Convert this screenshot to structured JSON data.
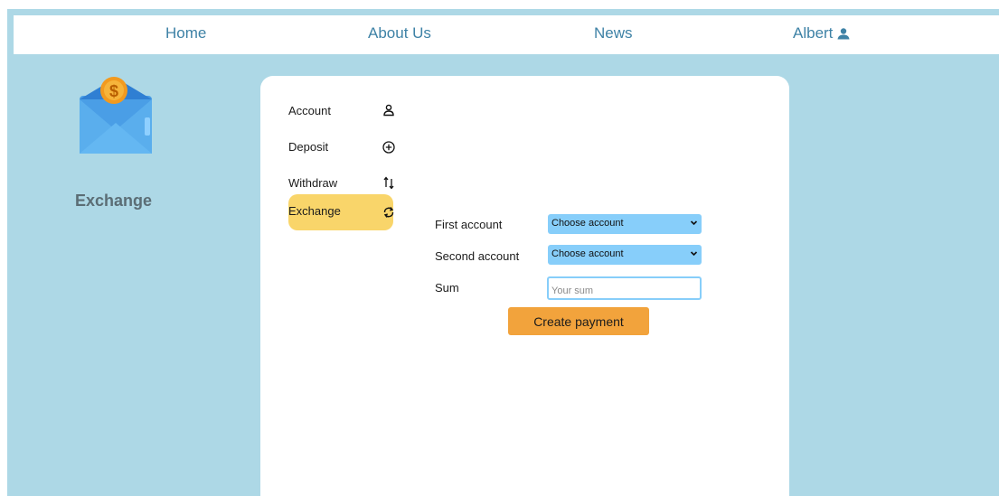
{
  "nav": {
    "home": "Home",
    "about": "About Us",
    "news": "News",
    "user": "Albert"
  },
  "page": {
    "heading": "Exchange"
  },
  "sidebar": {
    "items": [
      {
        "label": "Account",
        "icon": "user-outline-icon"
      },
      {
        "label": "Deposit",
        "icon": "plus-circle-icon"
      },
      {
        "label": "Withdraw",
        "icon": "arrows-up-down-icon"
      },
      {
        "label": "Exchange",
        "icon": "refresh-icon",
        "active": true
      }
    ]
  },
  "form": {
    "first_account_label": "First account",
    "first_account_value": "Choose account",
    "second_account_label": "Second account",
    "second_account_value": "Choose account",
    "sum_label": "Sum",
    "sum_placeholder": "Your sum",
    "submit_label": "Create payment"
  },
  "colors": {
    "background": "#add8e6",
    "nav_text": "#3e82a6",
    "active_item": "#f9d56a",
    "select": "#87cefa",
    "button": "#f2a33c"
  }
}
